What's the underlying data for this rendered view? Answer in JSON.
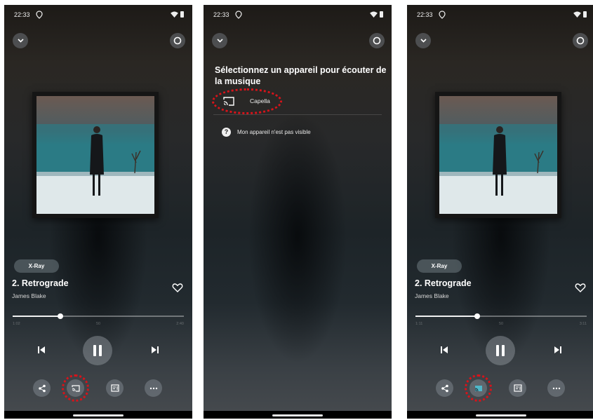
{
  "colors": {
    "highlight": "#d8131a",
    "cast_active": "#4fb7c9",
    "text": "#ffffff"
  },
  "screens": [
    {
      "status": {
        "time": "22:33"
      },
      "player": {
        "xray_label": "X-Ray",
        "track_title": "2. Retrograde",
        "artist": "James Blake",
        "progress_fraction": 0.28,
        "time_elapsed": "1:02",
        "time_mid": "50",
        "time_total": "2:40",
        "cast_active": false
      },
      "highlighted": "cast-button"
    },
    {
      "status": {
        "time": "22:33"
      },
      "device_picker": {
        "heading": "Sélectionnez un appareil pour écouter de la musique",
        "device_name": "Capella",
        "help_text": "Mon appareil n'est pas visible"
      },
      "highlighted": "device-capella"
    },
    {
      "status": {
        "time": "22:33"
      },
      "player": {
        "xray_label": "X-Ray",
        "track_title": "2. Retrograde",
        "artist": "James Blake",
        "progress_fraction": 0.36,
        "time_elapsed": "1:11",
        "time_mid": "50",
        "time_total": "3:11",
        "cast_active": true
      },
      "highlighted": "cast-button"
    }
  ]
}
